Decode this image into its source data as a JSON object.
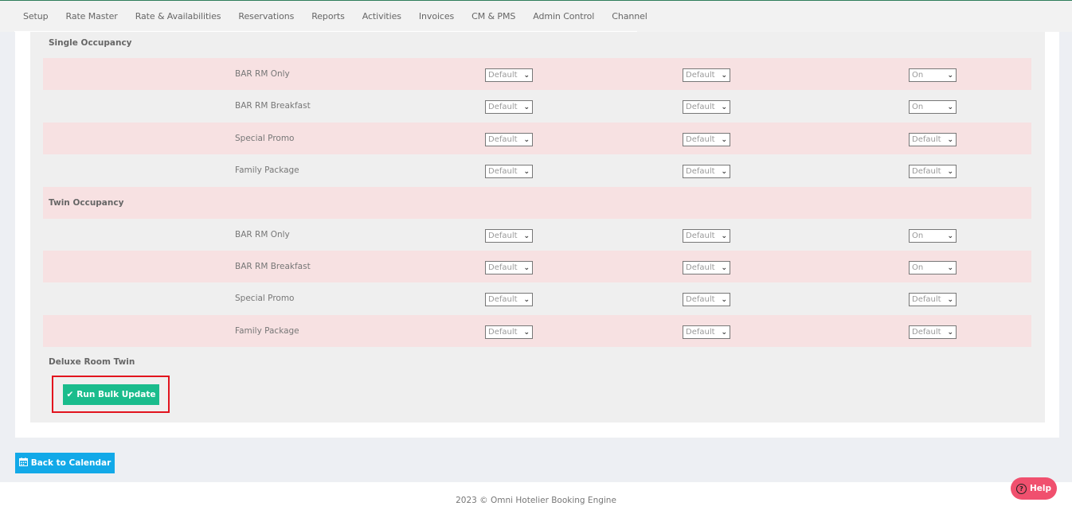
{
  "nav": [
    "Setup",
    "Rate Master",
    "Rate & Availabilities",
    "Reservations",
    "Reports",
    "Activities",
    "Invoices",
    "CM & PMS",
    "Admin Control",
    "Channel"
  ],
  "sections": [
    {
      "title": "Single Occupancy",
      "rows": [
        {
          "label": "BAR RM Only",
          "a": "Default",
          "b": "Default",
          "c": "On"
        },
        {
          "label": "BAR RM Breakfast",
          "a": "Default",
          "b": "Default",
          "c": "On"
        },
        {
          "label": "Special Promo",
          "a": "Default",
          "b": "Default",
          "c": "Default"
        },
        {
          "label": "Family Package",
          "a": "Default",
          "b": "Default",
          "c": "Default"
        }
      ]
    },
    {
      "title": "Twin Occupancy",
      "rows": [
        {
          "label": "BAR RM Only",
          "a": "Default",
          "b": "Default",
          "c": "On"
        },
        {
          "label": "BAR RM Breakfast",
          "a": "Default",
          "b": "Default",
          "c": "On"
        },
        {
          "label": "Special Promo",
          "a": "Default",
          "b": "Default",
          "c": "Default"
        },
        {
          "label": "Family Package",
          "a": "Default",
          "b": "Default",
          "c": "Default"
        }
      ]
    },
    {
      "title": "Deluxe Room Twin",
      "rows": []
    }
  ],
  "buttons": {
    "run_bulk": "Run Bulk Update",
    "back": "Back to Calendar",
    "help": "Help"
  },
  "footer": "2023 © Omni Hotelier Booking Engine",
  "icons": {
    "check": "check-icon",
    "calendar": "calendar-icon",
    "help": "question-circle-icon"
  },
  "colors": {
    "run_button": "#1abc8c",
    "back_button": "#12a9e8",
    "help_button": "#f0506e",
    "highlight_border": "#e2141e",
    "pink_row": "#f7e1e2"
  }
}
